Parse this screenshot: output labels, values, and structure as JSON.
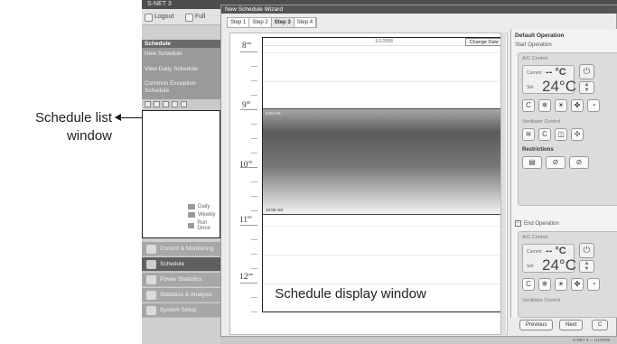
{
  "callout": {
    "line1": "Schedule list",
    "line2": "window"
  },
  "app": {
    "title": "S-NET 3",
    "toolbar": {
      "logout": "Logout",
      "full": "Full"
    }
  },
  "left_panel": {
    "schedule_header": "Schedule",
    "schedule_menu": [
      "New Schedule",
      "View Daily Schedule",
      "Common Exception Schedule"
    ],
    "list_entries": [
      "Daily",
      "Weekly",
      "Run Once"
    ],
    "nav": [
      "Control & Monitoring",
      "Schedule",
      "Power Statistics",
      "Statistics & Analysis",
      "System Setup"
    ]
  },
  "wizard": {
    "title": "New Schedule Wizard",
    "steps": [
      "Step 1",
      "Step 2",
      "Step 3",
      "Step 4"
    ],
    "active_step": "Step 3",
    "date": "1/1/2008",
    "change_date": "Change Date",
    "times": [
      {
        "hour": "8",
        "suffix": "am"
      },
      {
        "hour": "9",
        "suffix": "00"
      },
      {
        "hour": "10",
        "suffix": "00"
      },
      {
        "hour": "11",
        "suffix": "00"
      },
      {
        "hour": "12",
        "suffix": "pm"
      }
    ],
    "event_start": "9:00 AM",
    "event_end": "10:59 AM",
    "display_caption": "Schedule display window"
  },
  "right_panel": {
    "title": "Default Operation",
    "start_label": "Start Operation",
    "ac_control": "A/C Control",
    "current_label": "Current",
    "current_value": "-- °C",
    "set_label": "Set",
    "set_value": "24°C",
    "ventilator_control": "Ventilator Control",
    "restrictions": "Restrictions",
    "end_label": "End Operation"
  },
  "buttons": {
    "previous": "Previous",
    "next": "Next",
    "cancel": "C"
  },
  "status": "S-NET 3 ... 1/1/2008"
}
